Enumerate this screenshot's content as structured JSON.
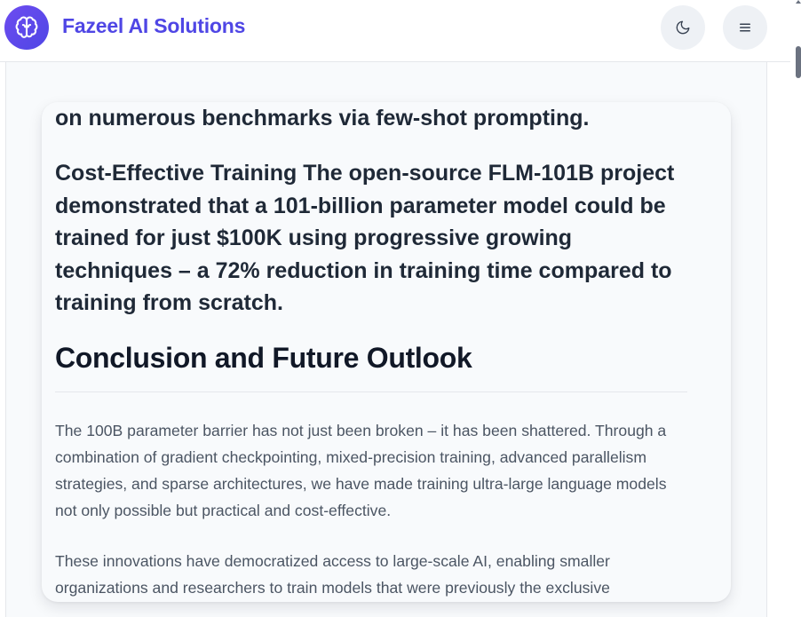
{
  "header": {
    "brand": "Fazeel AI Solutions",
    "logo_icon": "brain-icon",
    "theme_icon": "moon-icon",
    "menu_icon": "hamburger-menu-icon"
  },
  "article": {
    "lead_fragment": "on numerous benchmarks via few-shot prompting.",
    "cost_paragraph": "Cost-Effective Training The open-source FLM-101B project demonstrated that a 101-billion parameter model could be trained for just $100K using progressive growing techniques – a 72% reduction in training time compared to training from scratch.",
    "section_heading": "Conclusion and Future Outlook",
    "paragraphs": [
      "The 100B parameter barrier has not just been broken – it has been shattered. Through a combination of gradient checkpointing, mixed-precision training, advanced parallelism strategies, and sparse architectures, we have made training ultra-large language models not only possible but practical and cost-effective.",
      "These innovations have democratized access to large-scale AI, enabling smaller organizations and researchers to train models that were previously the exclusive"
    ]
  },
  "colors": {
    "brand": "#4f46e5",
    "heading": "#111827",
    "body_text": "#4b5563",
    "button_bg": "#eef1f5"
  }
}
